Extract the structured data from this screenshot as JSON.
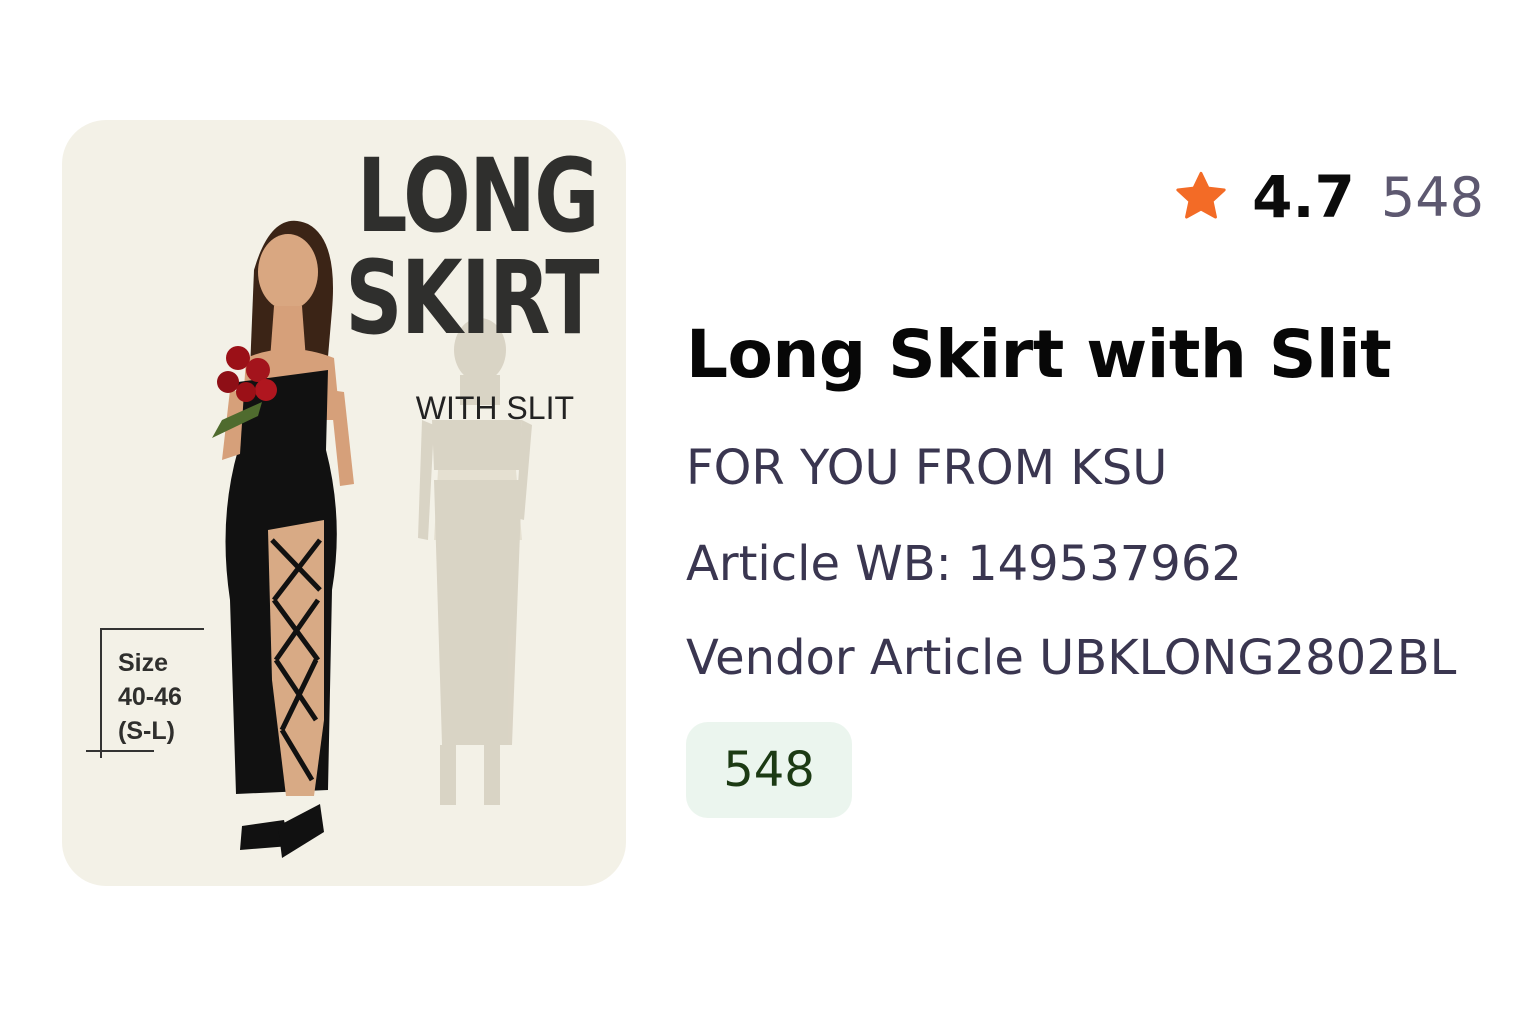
{
  "image": {
    "poster_title": "LONG SKIRT",
    "poster_subtitle": "WITH SLIT",
    "size_label": "Size",
    "size_range": "40-46",
    "size_letters": "(S-L)"
  },
  "rating": {
    "icon": "star-icon",
    "value": "4.7",
    "reviews": "548",
    "star_color": "#f36b26"
  },
  "product": {
    "title": "Long Skirt with Slit",
    "brand": "FOR YOU FROM KSU",
    "article_wb": "Article WB: 149537962",
    "vendor_article": "Vendor Article UBKLONG2802BL",
    "count": "548"
  },
  "colors": {
    "card_background": "#f3f1e7",
    "chip_background": "#ebf5ee",
    "chip_text": "#1c3a14",
    "secondary_text": "#3a3650"
  }
}
